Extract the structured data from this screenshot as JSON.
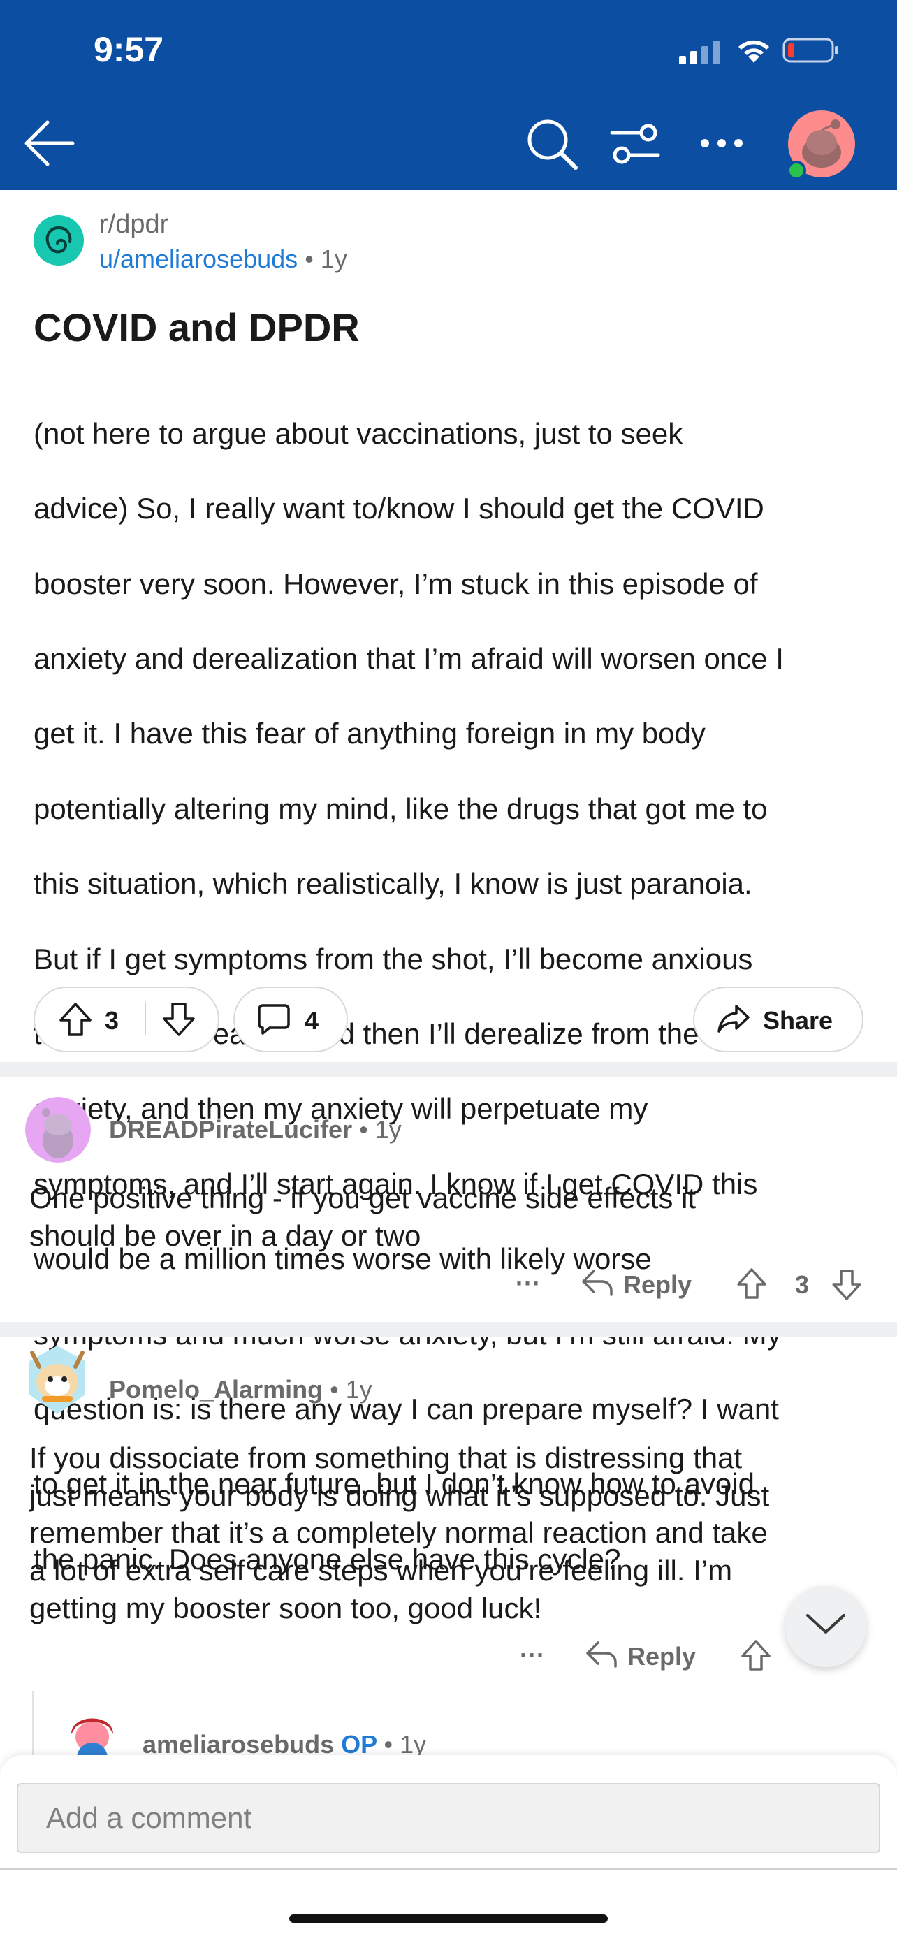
{
  "status_bar": {
    "time": "9:57"
  },
  "header": {
    "back_icon": "arrow-left-icon",
    "search_icon": "search-icon",
    "filter_icon": "sort-filter-icon",
    "more_icon": "more-horizontal-icon",
    "avatar_icon": "snoo-avatar-icon",
    "color": "#0b4ea2"
  },
  "post": {
    "subreddit": "r/dpdr",
    "author": "u/ameliarosebuds",
    "time": "• 1y",
    "title": "COVID and DPDR",
    "body_lines": [
      "(not here to argue about vaccinations, just to seek",
      "advice) So, I really want to/know I should get the COVID",
      "booster very soon. However, I’m stuck in this episode of",
      "anxiety and derealization that I’m afraid will worsen once I",
      "get it. I have this fear of anything foreign in my body",
      "potentially altering my mind, like the drugs that got me to",
      "this situation, which realistically, I know is just paranoia.",
      "But if I get symptoms from the shot, I’ll become anxious",
      "that I may derealize, and then I’ll derealize from the",
      "anxiety, and then my anxiety will perpetuate my",
      "symptoms, and I’ll start again. I know if I get COVID this",
      "would be a million times worse with likely worse",
      "symptoms and much worse anxiety, but I’m still afraid. My",
      "question is: is there any way I can prepare myself? I want",
      "to get it in the near future, but I don’t know how to avoid",
      "the panic. Does anyone else have this cycle?"
    ],
    "votes": "3",
    "comments": "4",
    "share_label": "Share"
  },
  "comments": [
    {
      "user": "DREADPirateLucifer",
      "time": "• 1y",
      "body_lines": [
        "One positive thing - if you get vaccine side effects it",
        "should be over in a day or two"
      ],
      "more": "···",
      "reply_label": "Reply",
      "votes": "3"
    },
    {
      "user": "Pomelo_Alarming",
      "time": "• 1y",
      "body_lines": [
        "If you dissociate from something that is distressing that",
        "just means your body is doing what it’s supposed to. Just",
        "remember that it’s a completely normal reaction and take",
        "a lot of extra self care steps when you’re feeling ill. I’m",
        "getting my booster soon too, good luck!"
      ],
      "more": "···",
      "reply_label": "Reply"
    },
    {
      "user": "ameliarosebuds",
      "op_label": "OP",
      "time": "• 1y"
    }
  ],
  "composer": {
    "placeholder": "Add a comment"
  },
  "colors": {
    "accent_blue": "#1f7bd6",
    "separator": "#eef0f1"
  }
}
